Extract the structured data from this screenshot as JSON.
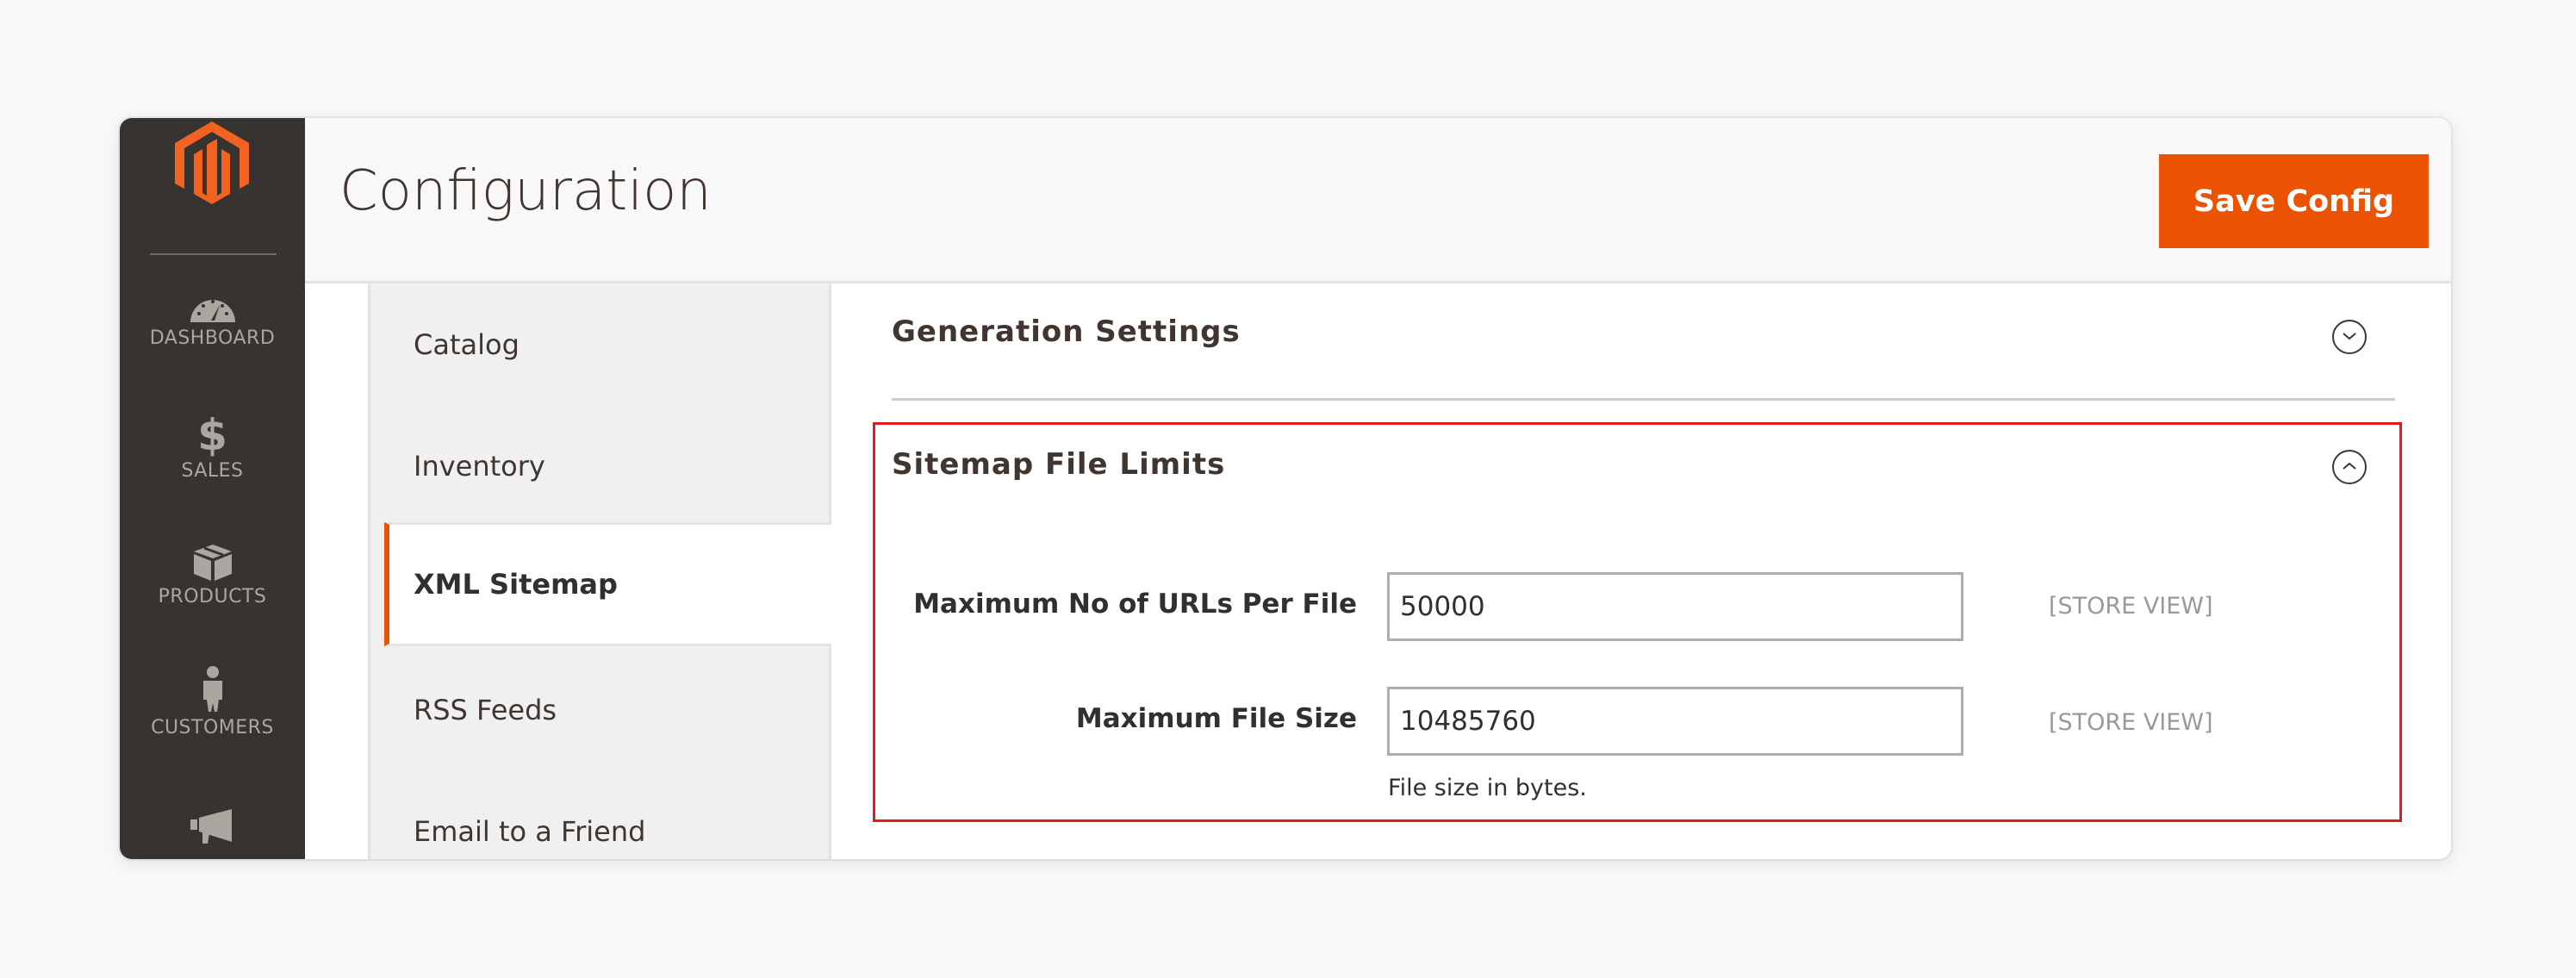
{
  "sidebar": {
    "logo": "magento-logo",
    "items": [
      {
        "label": "DASHBOARD",
        "icon": "dashboard-icon"
      },
      {
        "label": "SALES",
        "icon": "dollar-icon"
      },
      {
        "label": "PRODUCTS",
        "icon": "box-icon"
      },
      {
        "label": "CUSTOMERS",
        "icon": "person-icon"
      },
      {
        "label": "",
        "icon": "megaphone-icon"
      }
    ]
  },
  "header": {
    "title": "Configuration",
    "save_label": "Save Config"
  },
  "tabs": [
    {
      "label": "Catalog",
      "active": false
    },
    {
      "label": "Inventory",
      "active": false
    },
    {
      "label": "XML Sitemap",
      "active": true
    },
    {
      "label": "RSS Feeds",
      "active": false
    },
    {
      "label": "Email to a Friend",
      "active": false
    }
  ],
  "sections": [
    {
      "title": "Generation Settings",
      "state": "collapsed",
      "icon": "chevron-down-icon"
    },
    {
      "title": "Sitemap File Limits",
      "state": "expanded",
      "icon": "chevron-up-icon",
      "fields": [
        {
          "label": "Maximum No of URLs Per File",
          "value": "50000",
          "scope": "[STORE VIEW]"
        },
        {
          "label": "Maximum File Size",
          "value": "10485760",
          "scope": "[STORE VIEW]",
          "note": "File size in bytes."
        }
      ]
    }
  ],
  "colors": {
    "accent": "#eb5202",
    "sidebar_bg": "#373330",
    "highlight": "#e31b1b"
  }
}
